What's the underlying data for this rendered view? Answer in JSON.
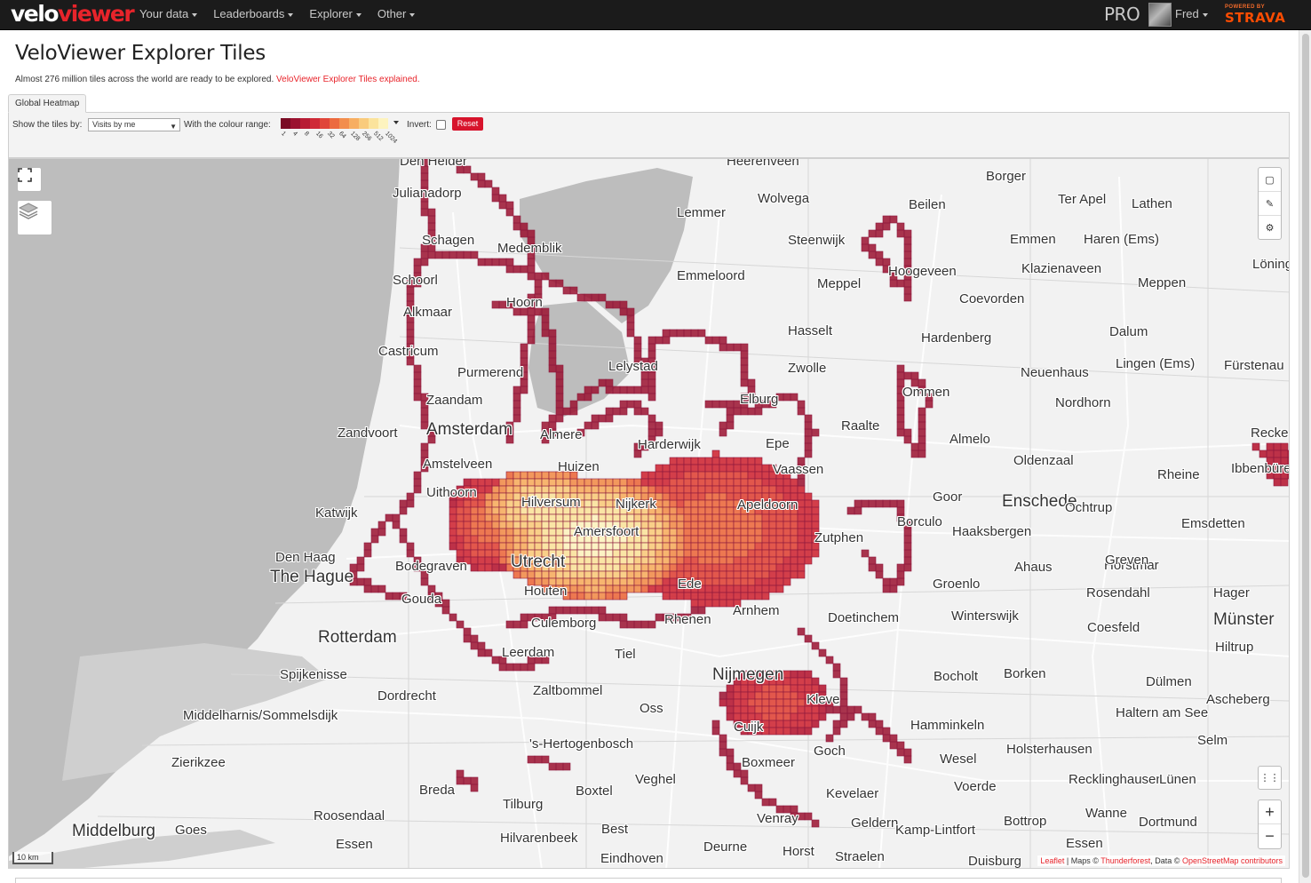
{
  "nav": {
    "brand_part1": "velo",
    "brand_part2": "viewer",
    "menu": [
      "Your data",
      "Leaderboards",
      "Explorer",
      "Other"
    ],
    "pro_label": "PRO",
    "user_name": "Fred",
    "strava_powered": "POWERED BY",
    "strava_logo": "STRAVA"
  },
  "page": {
    "title": "VeloViewer Explorer Tiles",
    "intro_text": "Almost 276 million tiles across the world are ready to be explored. ",
    "intro_link": "VeloViewer Explorer Tiles explained."
  },
  "tabs": [
    "Global Heatmap"
  ],
  "controls": {
    "show_by_label": "Show the tiles by:",
    "show_by_value": "Visits by me",
    "colour_range_label": "With the colour range:",
    "colour_ramp": [
      "#7a0b24",
      "#9b1230",
      "#b71c35",
      "#cf2a37",
      "#e0463a",
      "#ec6a3f",
      "#f28e4d",
      "#f7ae61",
      "#f9cb7c",
      "#fbe39c",
      "#fdf3bf"
    ],
    "colour_ramp_labels": [
      "1",
      "4",
      "8",
      "16",
      "32",
      "64",
      "128",
      "256",
      "512",
      "1024"
    ],
    "invert_label": "Invert:",
    "invert_checked": false,
    "reset_label": "Reset"
  },
  "map": {
    "places": [
      {
        "name": "Den Helder"
      },
      {
        "name": "Julianadorp"
      },
      {
        "name": "Schagen"
      },
      {
        "name": "Medemblik"
      },
      {
        "name": "Schoorl"
      },
      {
        "name": "Hoorn"
      },
      {
        "name": "Alkmaar"
      },
      {
        "name": "Castricum"
      },
      {
        "name": "Purmerend"
      },
      {
        "name": "Zaandam"
      },
      {
        "name": "Zandvoort"
      },
      {
        "name": "Amsterdam"
      },
      {
        "name": "Amstelveen"
      },
      {
        "name": "Almere"
      },
      {
        "name": "Lelystad"
      },
      {
        "name": "Harderwijk"
      },
      {
        "name": "Huizen"
      },
      {
        "name": "Hilversum"
      },
      {
        "name": "Uithoorn"
      },
      {
        "name": "Katwijk"
      },
      {
        "name": "Nijkerk"
      },
      {
        "name": "Amersfoort"
      },
      {
        "name": "Apeldoorn"
      },
      {
        "name": "Ede"
      },
      {
        "name": "Den Haag"
      },
      {
        "name": "The Hague"
      },
      {
        "name": "Bodegraven"
      },
      {
        "name": "Utrecht"
      },
      {
        "name": "Houten"
      },
      {
        "name": "Gouda"
      },
      {
        "name": "Culemborg"
      },
      {
        "name": "Rhenen"
      },
      {
        "name": "Arnhem"
      },
      {
        "name": "Zutphen"
      },
      {
        "name": "Rotterdam"
      },
      {
        "name": "Leerdam"
      },
      {
        "name": "Tiel"
      },
      {
        "name": "Spijkenisse"
      },
      {
        "name": "Dordrecht"
      },
      {
        "name": "Zaltbommel"
      },
      {
        "name": "Nijmegen"
      },
      {
        "name": "Doetinchem"
      },
      {
        "name": "Bocholt"
      },
      {
        "name": "Borken"
      },
      {
        "name": "Middelharnis/Sommelsdijk"
      },
      {
        "name": "Oss"
      },
      {
        "name": "Kleve"
      },
      {
        "name": "Cuijk"
      },
      {
        "name": "'s-Hertogenbosch"
      },
      {
        "name": "Goch"
      },
      {
        "name": "Zierikzee"
      },
      {
        "name": "Boxmeer"
      },
      {
        "name": "Breda"
      },
      {
        "name": "Boxtel"
      },
      {
        "name": "Veghel"
      },
      {
        "name": "Kevelaer"
      },
      {
        "name": "Tilburg"
      },
      {
        "name": "Roosendaal"
      },
      {
        "name": "Middelburg"
      },
      {
        "name": "Goes"
      },
      {
        "name": "Hilvarenbeek"
      },
      {
        "name": "Best"
      },
      {
        "name": "Essen"
      },
      {
        "name": "Eindhoven"
      },
      {
        "name": "Deurne"
      },
      {
        "name": "Venray"
      },
      {
        "name": "Horst"
      },
      {
        "name": "Straelen"
      },
      {
        "name": "Geldern"
      },
      {
        "name": "Kamp-Lintfort"
      },
      {
        "name": "Heerenveen"
      },
      {
        "name": "Wolvega"
      },
      {
        "name": "Lemmer"
      },
      {
        "name": "Steenwijk"
      },
      {
        "name": "Emmeloord"
      },
      {
        "name": "Meppel"
      },
      {
        "name": "Hoogeveen"
      },
      {
        "name": "Beilen"
      },
      {
        "name": "Borger"
      },
      {
        "name": "Ter Apel"
      },
      {
        "name": "Emmen"
      },
      {
        "name": "Klazienaveen"
      },
      {
        "name": "Coevorden"
      },
      {
        "name": "Hasselt"
      },
      {
        "name": "Zwolle"
      },
      {
        "name": "Hardenberg"
      },
      {
        "name": "Elburg"
      },
      {
        "name": "Ommen"
      },
      {
        "name": "Raalte"
      },
      {
        "name": "Epe"
      },
      {
        "name": "Vaassen"
      },
      {
        "name": "Almelo"
      },
      {
        "name": "Nordhorn"
      },
      {
        "name": "Neuenhaus"
      },
      {
        "name": "Oldenzaal"
      },
      {
        "name": "Goor"
      },
      {
        "name": "Enschede"
      },
      {
        "name": "Ochtrup"
      },
      {
        "name": "Haaksbergen"
      },
      {
        "name": "Ahaus"
      },
      {
        "name": "Groenlo"
      },
      {
        "name": "Winterswijk"
      },
      {
        "name": "Rheine"
      },
      {
        "name": "Emsdetten"
      },
      {
        "name": "Horstmar"
      },
      {
        "name": "Greven"
      },
      {
        "name": "Rosendahl"
      },
      {
        "name": "Coesfeld"
      },
      {
        "name": "Münster"
      },
      {
        "name": "Dülmen"
      },
      {
        "name": "Haltern am See"
      },
      {
        "name": "Hamminkeln"
      },
      {
        "name": "Wesel"
      },
      {
        "name": "Holsterhausen"
      },
      {
        "name": "Voerde"
      },
      {
        "name": "Recklinghausen"
      },
      {
        "name": "Bottrop"
      },
      {
        "name": "Dortmund"
      },
      {
        "name": "Essen"
      },
      {
        "name": "Duisburg"
      },
      {
        "name": "Lathen"
      },
      {
        "name": "Haren (Ems)"
      },
      {
        "name": "Meppen"
      },
      {
        "name": "Dalum"
      },
      {
        "name": "Lingen (Ems)"
      },
      {
        "name": "Fürstenau"
      },
      {
        "name": "Ibbenbüren"
      },
      {
        "name": "Hiltrup"
      },
      {
        "name": "Ascheberg"
      },
      {
        "name": "Selm"
      },
      {
        "name": "Lünen"
      },
      {
        "name": "Wanne"
      },
      {
        "name": "Löningen"
      },
      {
        "name": "Recke"
      },
      {
        "name": "Hager"
      },
      {
        "name": "Borculo"
      }
    ],
    "scale_label": "10 km",
    "attribution_leaflet": "Leaflet",
    "attribution_maps": " | Maps © ",
    "attribution_thunderforest": "Thunderforest",
    "attribution_data": ", Data © ",
    "attribution_osm": "OpenStreetMap contributors",
    "zoom_in_label": "+",
    "zoom_out_label": "−",
    "colors": {
      "water": "#bdbdbd",
      "land": "#f2f2f2",
      "tile_outline": "#8c1a3e"
    }
  }
}
